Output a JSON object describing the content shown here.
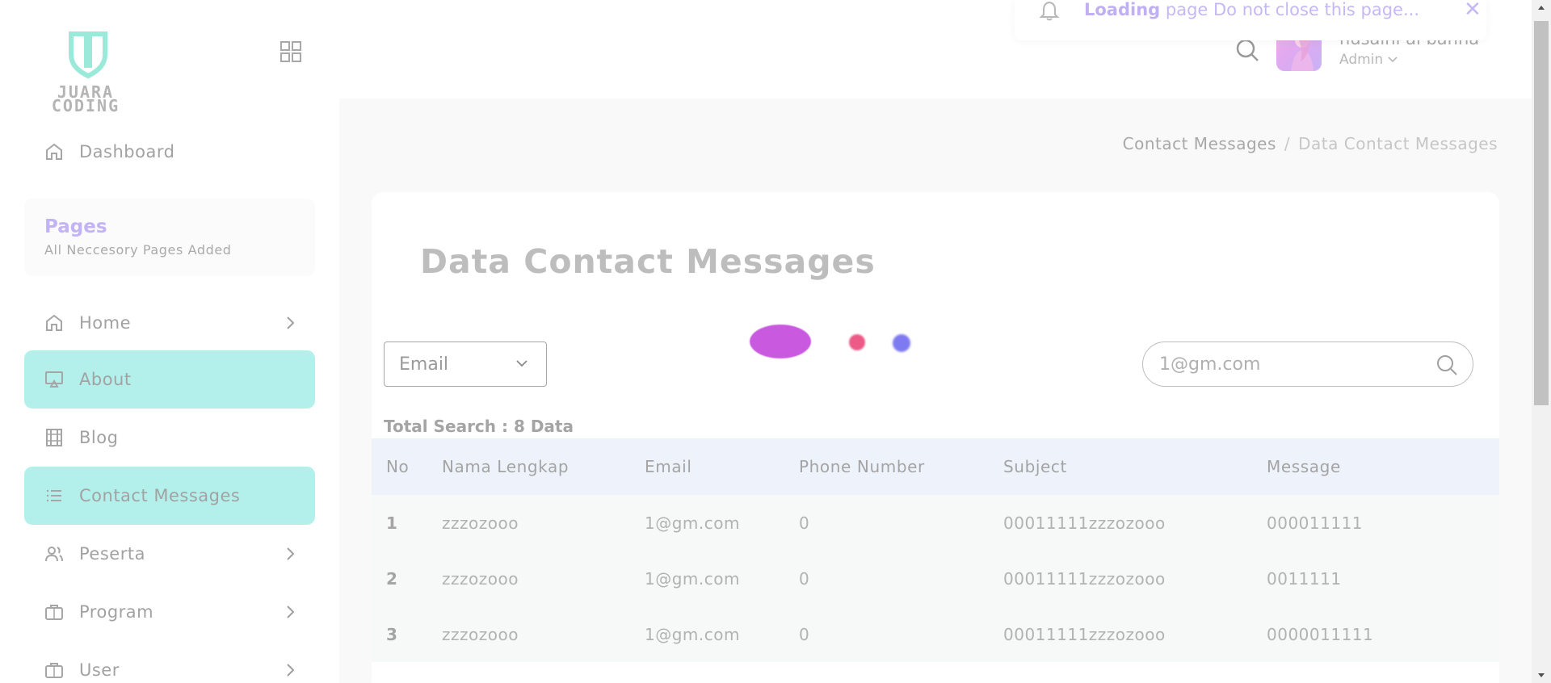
{
  "brand": {
    "logo_text_line1": "JUARA",
    "logo_text_line2": "CODING"
  },
  "toast": {
    "strong": "Loading",
    "message": " page Do not close this page..."
  },
  "header": {
    "user_name": "husaini al banna",
    "user_role": "Admin"
  },
  "sidebar": {
    "dashboard": "Dashboard",
    "pages_card": {
      "title": "Pages",
      "subtitle": "All Neccesory Pages Added"
    },
    "items": [
      {
        "label": "Home",
        "icon": "home-icon",
        "chevron": true,
        "active": false
      },
      {
        "label": "About",
        "icon": "monitor-icon",
        "chevron": false,
        "active": true
      },
      {
        "label": "Blog",
        "icon": "film-icon",
        "chevron": false,
        "active": false
      },
      {
        "label": "Contact Messages",
        "icon": "list-icon",
        "chevron": false,
        "active": true
      },
      {
        "label": "Peserta",
        "icon": "users-icon",
        "chevron": true,
        "active": false
      },
      {
        "label": "Program",
        "icon": "briefcase-icon",
        "chevron": true,
        "active": false
      },
      {
        "label": "User",
        "icon": "briefcase-icon",
        "chevron": true,
        "active": false
      }
    ]
  },
  "breadcrumb": {
    "parent": "Contact Messages",
    "separator": "/",
    "current": "Data Contact Messages"
  },
  "main": {
    "title": "Data Contact Messages",
    "filter_select": "Email",
    "search_value": "1@gm.com",
    "total_search": "Total Search : 8 Data"
  },
  "table": {
    "headers": [
      "No",
      "Nama Lengkap",
      "Email",
      "Phone Number",
      "Subject",
      "Message"
    ],
    "rows": [
      [
        "1",
        "zzzozooo",
        "1@gm.com",
        "0",
        "00011111zzzozooo",
        "000011111"
      ],
      [
        "2",
        "zzzozooo",
        "1@gm.com",
        "0",
        "00011111zzzozooo",
        "0011111"
      ],
      [
        "3",
        "zzzozooo",
        "1@gm.com",
        "0",
        "00011111zzzozooo",
        "0000011111"
      ]
    ]
  },
  "colors": {
    "active_nav": "#b3f0eb",
    "accent_purple": "#c2b3f5",
    "table_header": "#eef3fb",
    "loader": [
      "#c95ae0",
      "#ec5a88",
      "#7e7af0"
    ]
  }
}
